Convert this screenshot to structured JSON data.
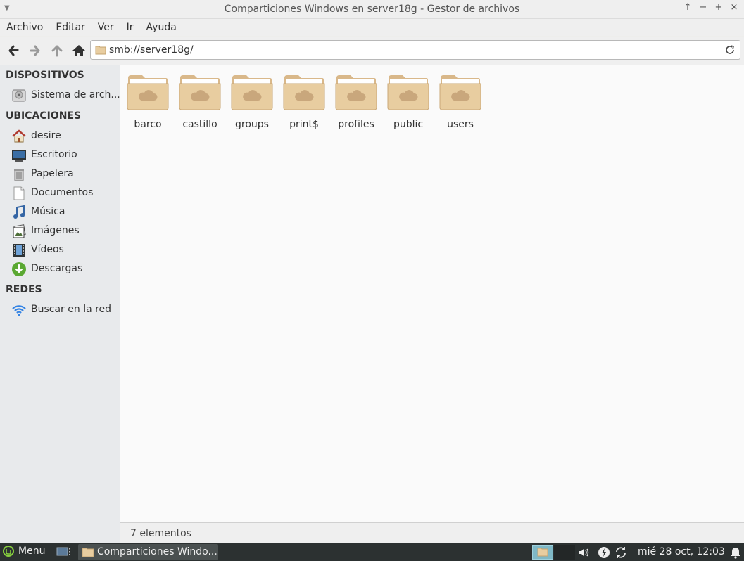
{
  "window": {
    "title": "Comparticiones Windows en server18g - Gestor de archivos",
    "controls": [
      "↑",
      "−",
      "+",
      "×"
    ]
  },
  "menubar": {
    "items": [
      "Archivo",
      "Editar",
      "Ver",
      "Ir",
      "Ayuda"
    ]
  },
  "toolbar": {
    "location": "smb://server18g/"
  },
  "sidebar": {
    "sections": [
      {
        "heading": "DISPOSITIVOS",
        "items": [
          {
            "label": "Sistema de arch...",
            "icon": "hard-drive-icon"
          }
        ]
      },
      {
        "heading": "UBICACIONES",
        "items": [
          {
            "label": "desire",
            "icon": "home-icon"
          },
          {
            "label": "Escritorio",
            "icon": "desktop-icon"
          },
          {
            "label": "Papelera",
            "icon": "trash-icon"
          },
          {
            "label": "Documentos",
            "icon": "document-icon"
          },
          {
            "label": "Música",
            "icon": "music-icon"
          },
          {
            "label": "Imágenes",
            "icon": "pictures-icon"
          },
          {
            "label": "Vídeos",
            "icon": "video-icon"
          },
          {
            "label": "Descargas",
            "icon": "download-icon"
          }
        ]
      },
      {
        "heading": "REDES",
        "items": [
          {
            "label": "Buscar en la red",
            "icon": "network-icon"
          }
        ]
      }
    ]
  },
  "content": {
    "folders": [
      "barco",
      "castillo",
      "groups",
      "print$",
      "profiles",
      "public",
      "users"
    ]
  },
  "statusbar": {
    "text": "7 elementos"
  },
  "taskbar": {
    "menu_label": "Menu",
    "task_label": "Comparticiones Windo...",
    "clock": "mié 28 oct, 12:03"
  },
  "colors": {
    "folder": "#e8cda0",
    "taskbar": "#2c3131",
    "sidebar": "#e8eaec",
    "workspace_active": "#7fb8c6"
  }
}
